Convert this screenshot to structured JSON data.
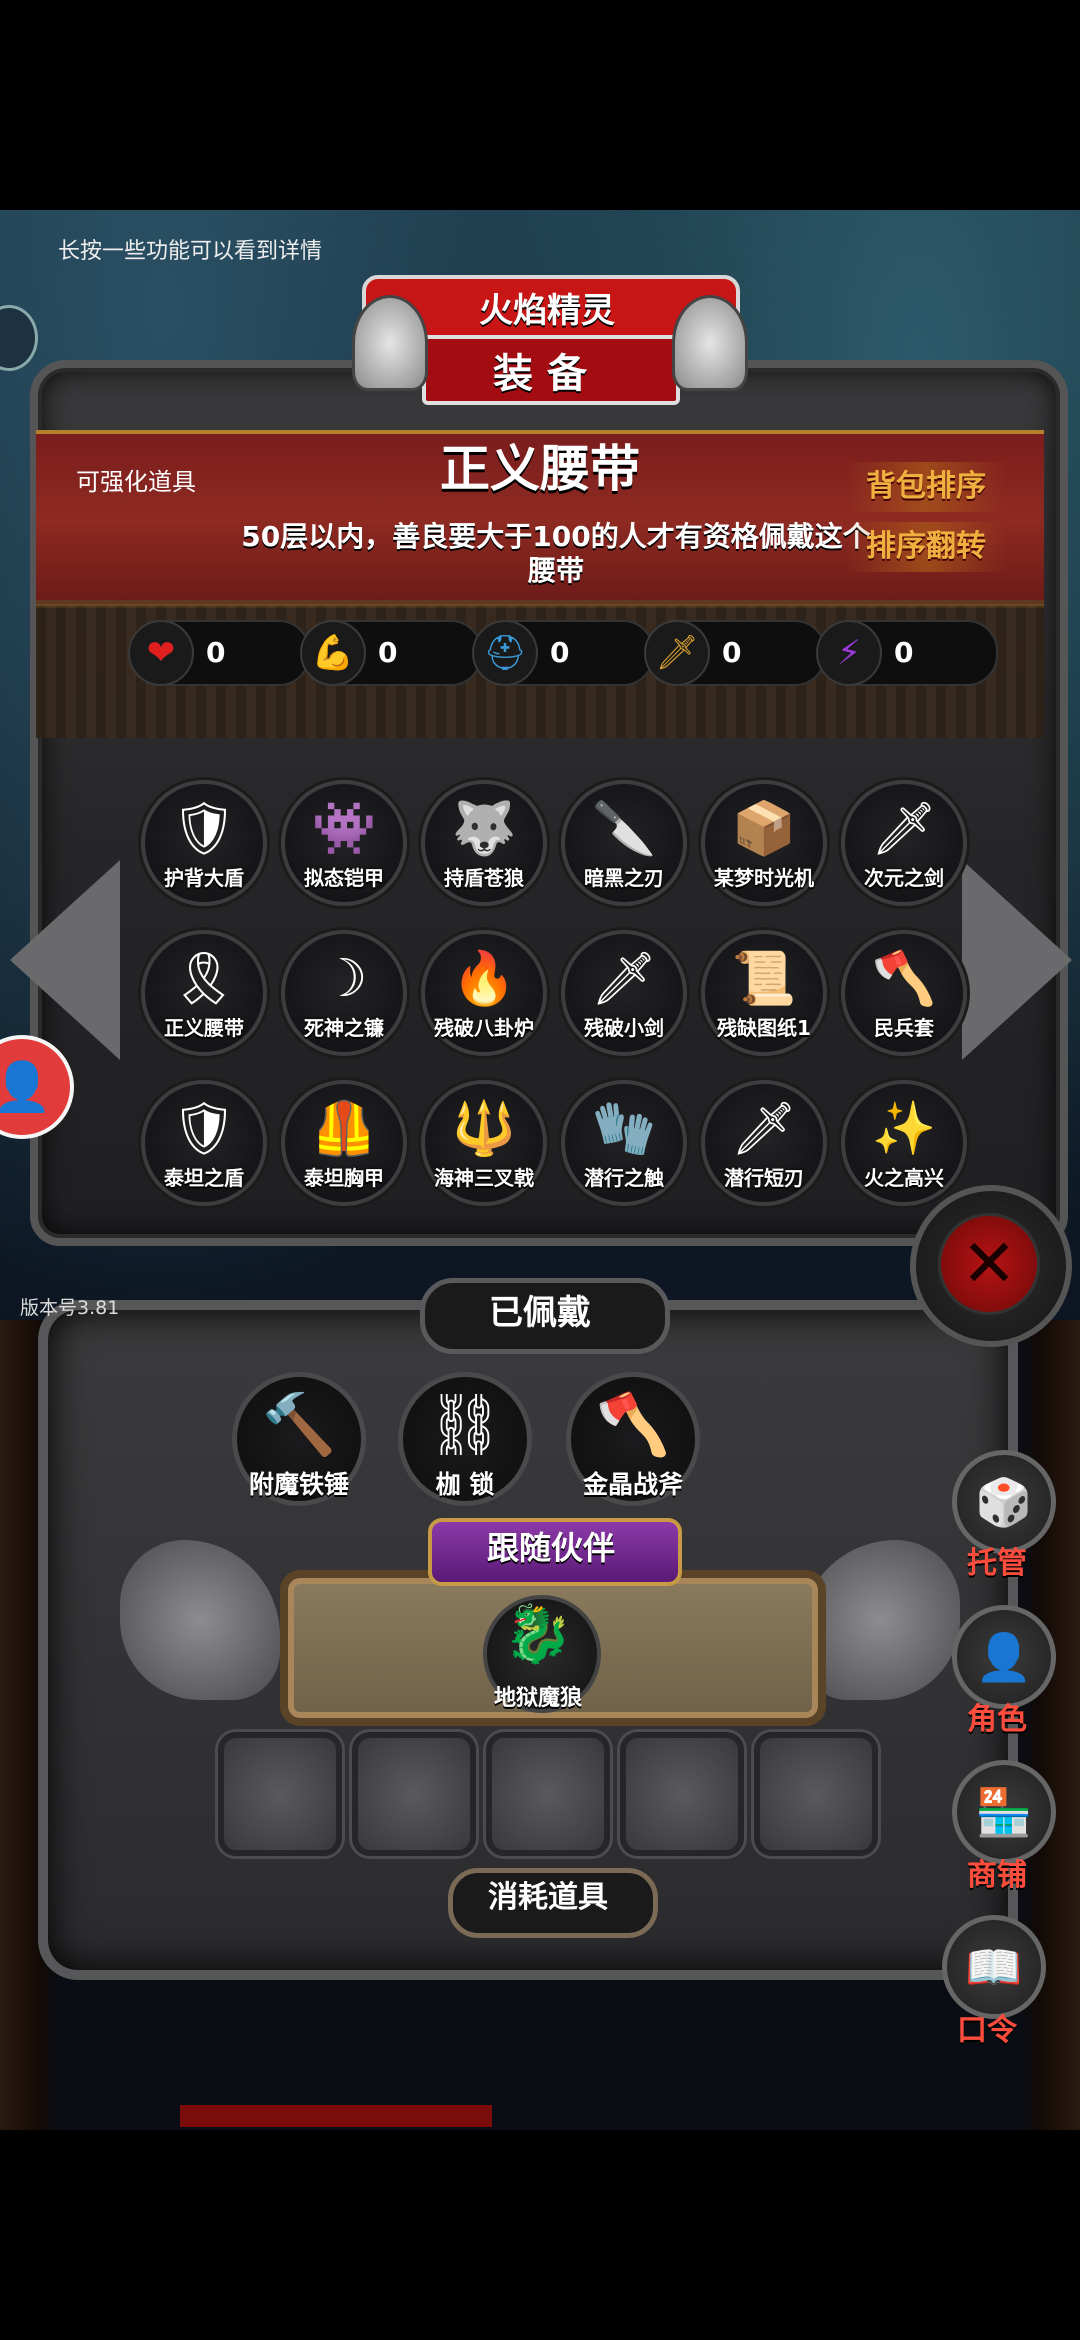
{
  "hint": "长按一些功能可以看到详情",
  "version": "版本号3.81",
  "header": {
    "character_name": "火焰精灵",
    "screen_title": "装备"
  },
  "item_info": {
    "enhance_label": "可强化道具",
    "name": "正义腰带",
    "description": "50层以内，善良要大于100的人才有资格佩戴这个腰带",
    "sort_button": "背包排序",
    "flip_button": "排序翻转"
  },
  "stats": [
    {
      "icon": "heart-icon",
      "glyph": "❤",
      "color": "#e02020",
      "value": "0"
    },
    {
      "icon": "strength-icon",
      "glyph": "💪",
      "color": "#e8b020",
      "value": "0"
    },
    {
      "icon": "helmet-icon",
      "glyph": "⛑",
      "color": "#3a9ad8",
      "value": "0"
    },
    {
      "icon": "sword-icon",
      "glyph": "🗡",
      "color": "#d8a030",
      "value": "0"
    },
    {
      "icon": "lightning-icon",
      "glyph": "⚡",
      "color": "#9a3ad8",
      "value": "0"
    }
  ],
  "inventory": [
    {
      "label": "护背大盾",
      "icon": "🛡"
    },
    {
      "label": "拟态铠甲",
      "icon": "👾"
    },
    {
      "label": "持盾苍狼",
      "icon": "🐺"
    },
    {
      "label": "暗黑之刃",
      "icon": "🔪"
    },
    {
      "label": "某梦时光机",
      "icon": "📦"
    },
    {
      "label": "次元之剑",
      "icon": "🗡"
    },
    {
      "label": "正义腰带",
      "icon": "🎗"
    },
    {
      "label": "死神之镰",
      "icon": "☽"
    },
    {
      "label": "残破八卦炉",
      "icon": "🔥"
    },
    {
      "label": "残破小剑",
      "icon": "🗡"
    },
    {
      "label": "残缺图纸1",
      "icon": "📜"
    },
    {
      "label": "民兵套",
      "icon": "🪓"
    },
    {
      "label": "泰坦之盾",
      "icon": "🛡"
    },
    {
      "label": "泰坦胸甲",
      "icon": "🦺"
    },
    {
      "label": "海神三叉戟",
      "icon": "🔱"
    },
    {
      "label": "潜行之触",
      "icon": "🧤"
    },
    {
      "label": "潜行短刃",
      "icon": "🗡"
    },
    {
      "label": "火之高兴",
      "icon": "✨"
    }
  ],
  "equipped": {
    "title": "已佩戴",
    "items": [
      {
        "label": "附魔铁锤",
        "icon": "🔨"
      },
      {
        "label": "枷 锁",
        "icon": "⛓"
      },
      {
        "label": "金晶战斧",
        "icon": "🪓"
      }
    ]
  },
  "companion": {
    "title": "跟随伙伴",
    "label": "地狱魔狼",
    "icon": "🐉"
  },
  "consumables": {
    "title": "消耗道具"
  },
  "side_menu": [
    {
      "label": "托管",
      "icon": "🎲"
    },
    {
      "label": "角色",
      "icon": "👤"
    },
    {
      "label": "商铺",
      "icon": "🏪"
    },
    {
      "label": "口令",
      "icon": "📖"
    }
  ]
}
